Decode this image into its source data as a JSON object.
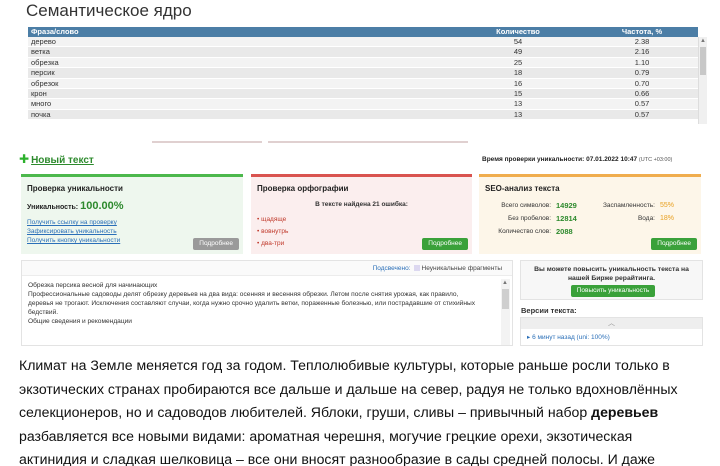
{
  "semantic": {
    "title": "Семантическое ядро",
    "headers": [
      "Фраза/слово",
      "Количество",
      "Частота, %"
    ],
    "rows": [
      [
        "дерево",
        "54",
        "2.38"
      ],
      [
        "ветка",
        "49",
        "2.16"
      ],
      [
        "обрезка",
        "25",
        "1.10"
      ],
      [
        "персик",
        "18",
        "0.79"
      ],
      [
        "обрезок",
        "16",
        "0.70"
      ],
      [
        "крон",
        "15",
        "0.66"
      ],
      [
        "много",
        "13",
        "0.57"
      ],
      [
        "почка",
        "13",
        "0.57"
      ]
    ]
  },
  "toolbar": {
    "new_text": "Новый текст",
    "check_time_label": "Время проверки уникальности: 07.01.2022 10:47",
    "check_time_tz": "(UTC +03:00)"
  },
  "uniqueness": {
    "title": "Проверка уникальности",
    "label": "Уникальность:",
    "value": "100.00%",
    "links": [
      "Получить ссылку на проверку",
      "Зафиксировать уникальность",
      "Получить кнопку уникальности"
    ],
    "more": "Подробнее"
  },
  "spelling": {
    "title": "Проверка орфографии",
    "found": "В тексте найдена 21 ошибка:",
    "errors": [
      "щадяще",
      "вовнутрь",
      "два-три"
    ],
    "more": "Подробнее"
  },
  "seo": {
    "title": "SEO-анализ текста",
    "total_label": "Всего символов:",
    "total": "14929",
    "nospace_label": "Без пробелов:",
    "nospace": "12814",
    "words_label": "Количество слов:",
    "words": "2088",
    "spam_label": "Заспамленность:",
    "spam": "55%",
    "water_label": "Вода:",
    "water": "18%",
    "more": "Подробнее"
  },
  "editor": {
    "legend_label": "Подсвечено:",
    "legend_item": "Неуникальные фрагменты",
    "lines": [
      "Обрезка персика весной для начинающих",
      "Профессиональные садоводы делят обрезку деревьев на два вида: осенняя и весенняя обрезки. Летом после снятия урожая, как правило,",
      "деревья не трогают. Исключения составляют случаи, когда нужно срочно удалить ветки, пораженные болезнью, или пострадавшие от стихийных",
      "бедствий.",
      "Общие сведения и рекомендации"
    ]
  },
  "promo": {
    "text_line1": "Вы можете повысить уникальность текста на",
    "text_line2": "нашей Бирже рерайтинга.",
    "button": "Повысить уникальность"
  },
  "versions": {
    "title": "Версии текста:",
    "item": "6 минут назад (uni: 100%)"
  },
  "article": {
    "line1": "Климат на Земле меняется год за годом. Теплолюбивые культуры, которые раньше росли только в",
    "line2": "экзотических странах пробираются все дальше и дальше на север, радуя не только вдохновлённых",
    "line3": "селекционеров, но и садоводов любителей. Яблоки, груши, сливы – привычный набор",
    "line3_bold": "деревьев",
    "line4": "разбавляется все новыми видами: ароматная черешня, могучие грецкие орехи, экзотическая",
    "line5": "актинидия и сладкая шелковица – все они вносят разнообразие в сады средней полосы. И даже"
  }
}
